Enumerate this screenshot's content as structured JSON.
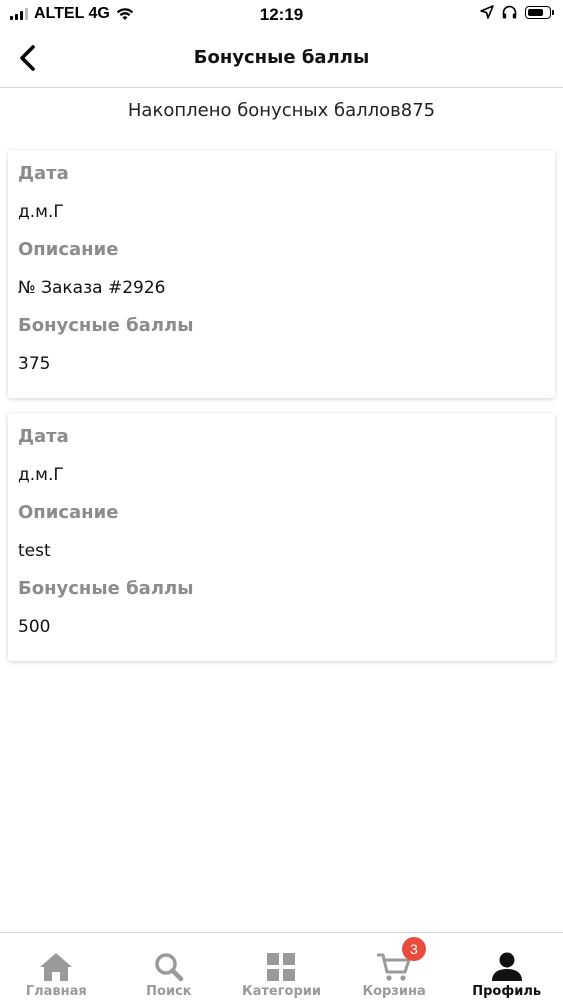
{
  "status_bar": {
    "carrier": "ALTEL 4G",
    "time": "12:19",
    "battery_level": 0.8
  },
  "header": {
    "title": "Бонусные баллы"
  },
  "summary": {
    "text": "Накоплено бонусных баллов875"
  },
  "entries": [
    {
      "date_label": "Дата",
      "date_value": "д.м.Г",
      "description_label": "Описание",
      "description_value": "№ Заказа #2926",
      "points_label": "Бонусные баллы",
      "points_value": "375"
    },
    {
      "date_label": "Дата",
      "date_value": "д.м.Г",
      "description_label": "Описание",
      "description_value": "test",
      "points_label": "Бонусные баллы",
      "points_value": "500"
    }
  ],
  "tabbar": {
    "tabs": [
      {
        "label": "Главная",
        "icon": "home-icon",
        "active": false
      },
      {
        "label": "Поиск",
        "icon": "search-icon",
        "active": false
      },
      {
        "label": "Категории",
        "icon": "grid-icon",
        "active": false
      },
      {
        "label": "Корзина",
        "icon": "cart-icon",
        "active": false,
        "badge": "3"
      },
      {
        "label": "Профиль",
        "icon": "person-icon",
        "active": true
      }
    ]
  },
  "colors": {
    "badge": "#e94b3c",
    "inactive_tab": "#9a9a9a",
    "active_tab": "#111111",
    "field_label": "#8c8c8c"
  }
}
